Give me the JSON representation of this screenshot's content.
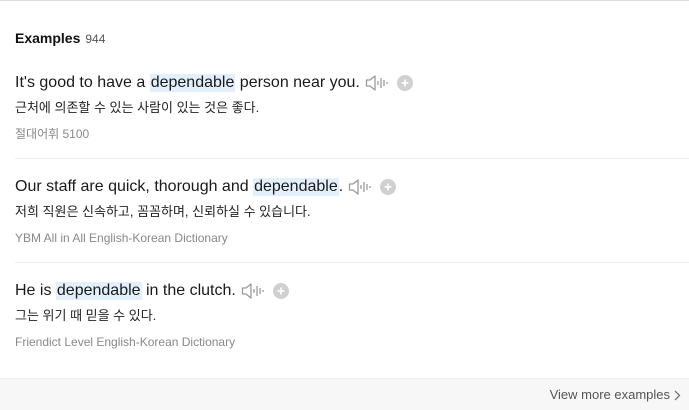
{
  "examples_section": {
    "title": "Examples",
    "count": "944"
  },
  "examples": [
    {
      "en_before": "It's good to have a ",
      "en_highlight": "dependable",
      "en_after": " person near you.",
      "ko": "근처에 의존할 수 있는 사람이 있는 것은 좋다.",
      "source": "절대어휘 5100"
    },
    {
      "en_before": "Our staff are quick, thorough and ",
      "en_highlight": "dependable",
      "en_after": ".",
      "ko": "저희 직원은 신속하고, 꼼꼼하며, 신뢰하실 수 있습니다.",
      "source": "YBM All in All English-Korean Dictionary"
    },
    {
      "en_before": "He is ",
      "en_highlight": "dependable",
      "en_after": " in the clutch.",
      "ko": "그는 위기 때 믿을 수 있다.",
      "source": "Friendict Level English-Korean Dictionary"
    }
  ],
  "footer": {
    "view_more_label": "View more examples"
  },
  "colors": {
    "highlight_bg": "#e3f0fb",
    "icon_gray": "#9a9a9a"
  },
  "icons": {
    "audio": "speaker-icon",
    "add": "plus-circle-icon",
    "more": "chevron-right-icon"
  }
}
